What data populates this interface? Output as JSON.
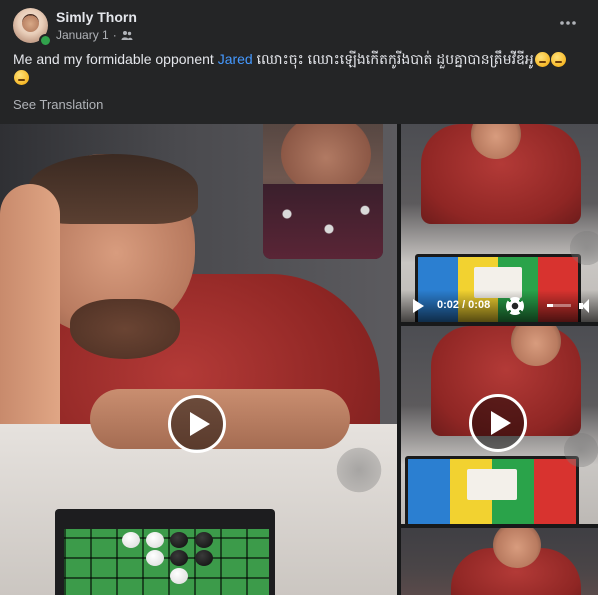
{
  "post": {
    "author": "Simly Thorn",
    "date": "January 1",
    "separator": "·",
    "privacy_icon": "friends-icon",
    "more_icon": "more-horizontal-icon",
    "text_before_mention": "Me and my formidable opponent ",
    "mention": "Jared",
    "text_after_mention": " ឈោះចុះ ឈោះឡើងកើតកូរីងបាត់ ដួបគ្នាបានត្រឹមវីឌីអូ",
    "see_translation": "See Translation"
  },
  "media": {
    "main_video_play_icon": "play-icon",
    "mid_video_play_icon": "play-icon",
    "player": {
      "time": "0:02 / 0:08",
      "progress": 0.25,
      "settings_icon": "gear-icon",
      "volume_icon": "speaker-icon"
    }
  },
  "colors": {
    "background": "#242526",
    "text_primary": "#e4e6eb",
    "text_secondary": "#b0b3b8",
    "mention": "#4599ff",
    "online": "#31a24c"
  }
}
